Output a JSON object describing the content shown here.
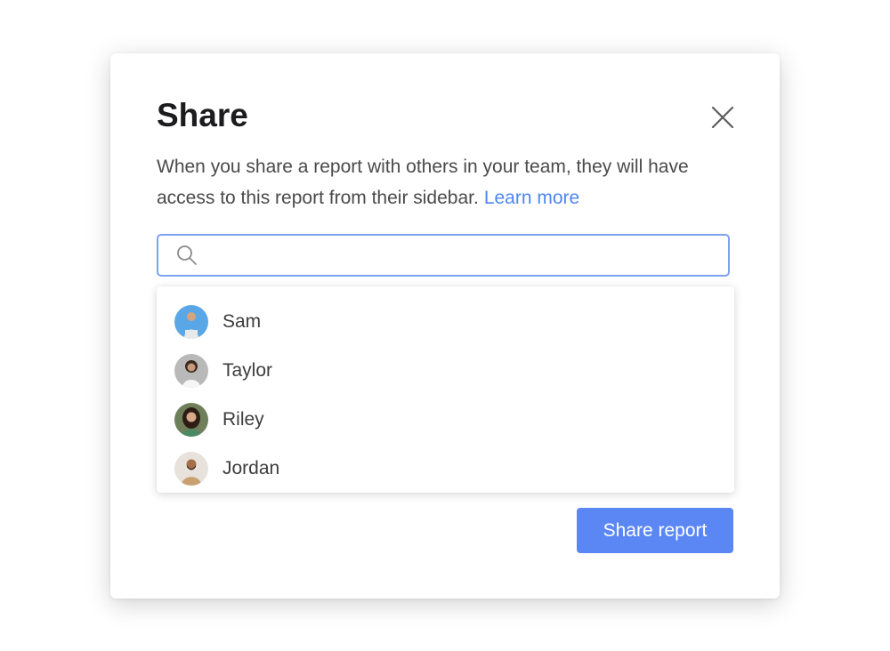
{
  "dialog": {
    "title": "Share",
    "description": "When you share a report with others in your team, they will have access to this report from their sidebar.",
    "learn_more_label": "Learn more",
    "close_icon": "close-icon"
  },
  "search": {
    "value": "",
    "placeholder": "",
    "icon": "search-icon",
    "border_color": "#7ea2f2"
  },
  "suggestions": [
    {
      "name": "Sam",
      "avatar_bg": "#5aa7e8"
    },
    {
      "name": "Taylor",
      "avatar_bg": "#b9b9b9"
    },
    {
      "name": "Riley",
      "avatar_bg": "#6f7f5a"
    },
    {
      "name": "Jordan",
      "avatar_bg": "#c9b59a"
    }
  ],
  "footer": {
    "share_label": "Share report",
    "accent_color": "#5b87f5"
  }
}
